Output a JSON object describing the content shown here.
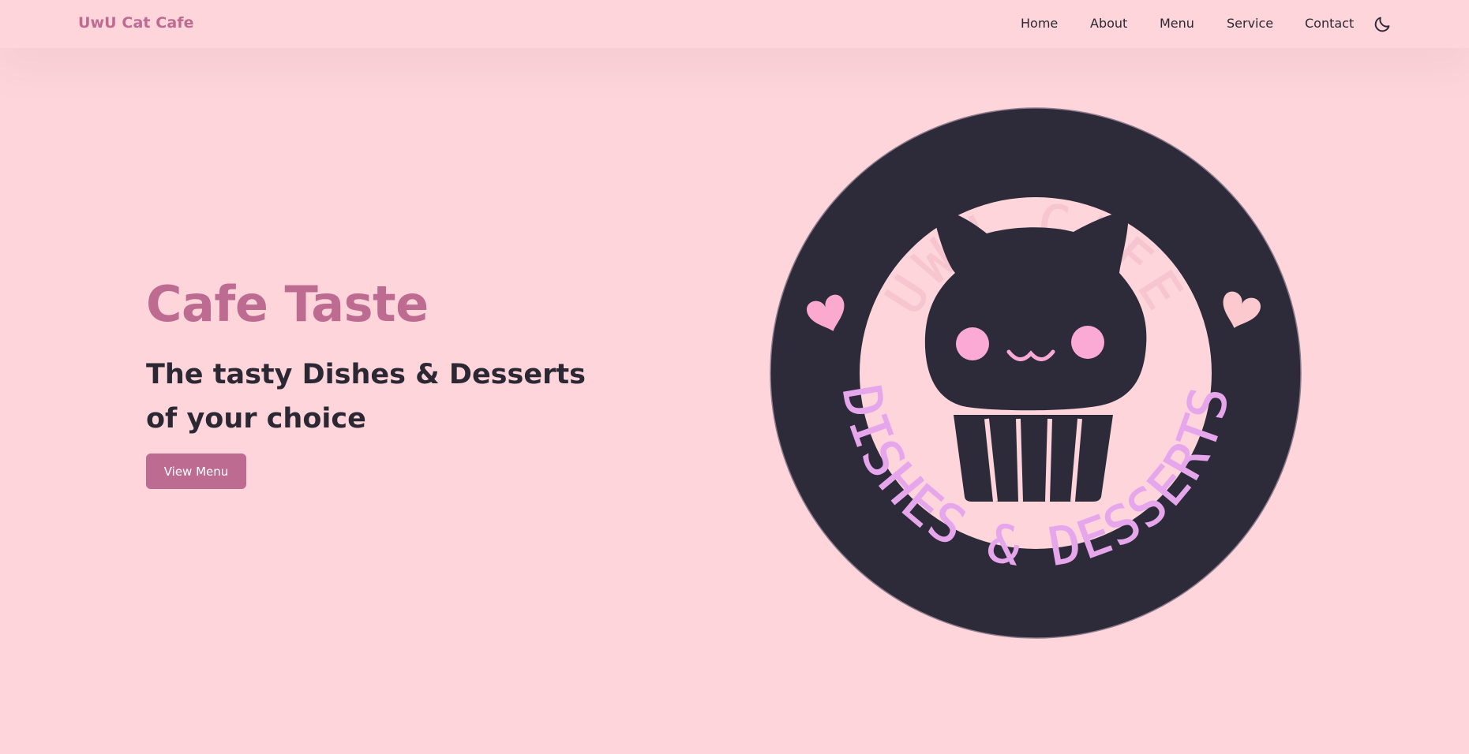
{
  "header": {
    "brand": "UwU Cat Cafe",
    "nav": [
      {
        "label": "Home"
      },
      {
        "label": "About"
      },
      {
        "label": "Menu"
      },
      {
        "label": "Service"
      },
      {
        "label": "Contact"
      }
    ],
    "theme_toggle_icon": "moon-icon"
  },
  "hero": {
    "title": "Cafe Taste",
    "subtitle_line1": "The tasty Dishes & Desserts",
    "subtitle_line2": "of your choice",
    "button_label": "View Menu"
  },
  "logo": {
    "top_text": "UWU CAFE",
    "bottom_text": "DISHES & DESSERTS"
  },
  "colors": {
    "background": "#fdd5db",
    "accent": "#bd6b91",
    "text_dark": "#2b2733",
    "logo_ring": "#2d2a3a",
    "logo_top_text": "#f7c5cf",
    "logo_bottom_text": "#e6a6ec",
    "heart_left": "#fba9cf",
    "heart_right": "#fcc9cf",
    "cheeks": "#fbaad6"
  }
}
